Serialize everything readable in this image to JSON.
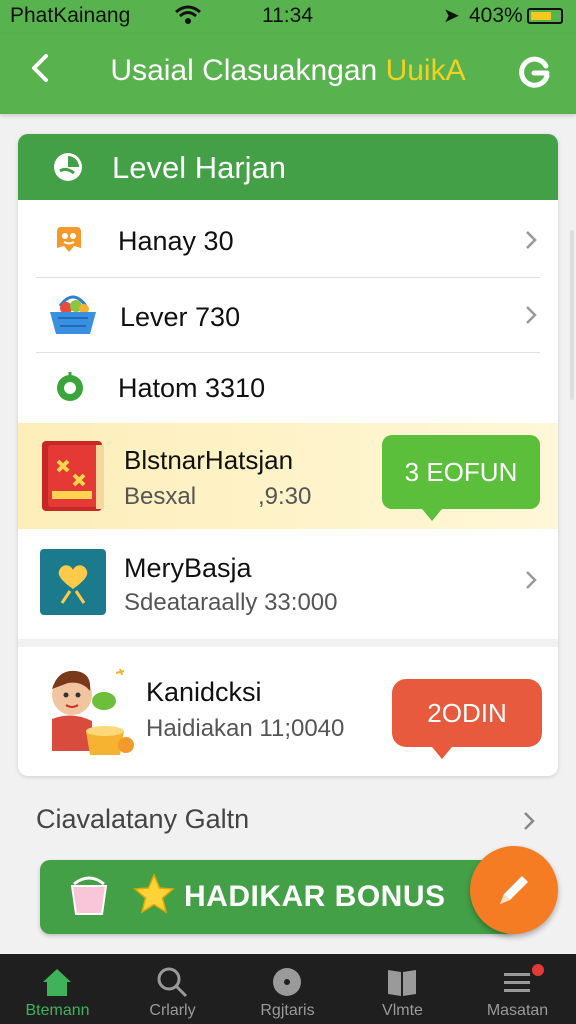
{
  "status_bar": {
    "carrier": "PhatKainang",
    "time": "11:34",
    "battery": "403%"
  },
  "header": {
    "title_main": "Usaial Clasuakngan ",
    "title_accent": "UuikA"
  },
  "level_card": {
    "title": "Level Harjan",
    "rows": [
      {
        "label": "Hanay 30"
      },
      {
        "label": "Lever 730"
      },
      {
        "label": "Hatom 3310"
      }
    ],
    "featured": [
      {
        "title": "BlstnarHatsjan",
        "subtitle": "Besxal",
        "value": ",9:30",
        "button": "3 EOFUN"
      },
      {
        "title": "MeryBasja",
        "subtitle": "Sdeataraally 33:000"
      },
      {
        "title": "Kanidcksi",
        "subtitle": "Haidiakan 11;0040",
        "button": "2ODIN"
      }
    ]
  },
  "footer_link": "Ciavalatany Galtn",
  "bonus_button": "HADIKAR BONUS",
  "tabs": [
    {
      "label": "Btemann",
      "icon": "home-icon",
      "active": true
    },
    {
      "label": "Crlarly",
      "icon": "search-icon"
    },
    {
      "label": "Rgjtaris",
      "icon": "record-icon"
    },
    {
      "label": "Vlmte",
      "icon": "book-icon"
    },
    {
      "label": "Masatan",
      "icon": "menu-icon"
    }
  ],
  "colors": {
    "primary_green": "#58b24e",
    "card_header_green": "#43a047",
    "accent_yellow": "#f2d024",
    "fab_orange": "#f57c22",
    "pill_green": "#5cbf3c",
    "pill_red": "#e85a3e",
    "tabbar": "#1f1f1f"
  }
}
